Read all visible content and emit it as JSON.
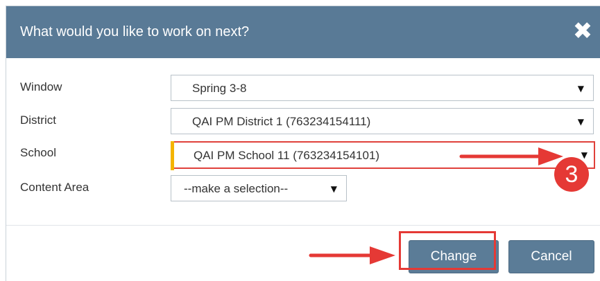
{
  "dialog": {
    "title": "What would you like to work on next?",
    "close_icon": "close-icon",
    "header_color": "#597a96"
  },
  "form": {
    "window": {
      "label": "Window",
      "value": "Spring 3-8"
    },
    "district": {
      "label": "District",
      "value": "QAI PM District 1 (763234154111)"
    },
    "school": {
      "label": "School",
      "value": "QAI PM School 11 (763234154101)"
    },
    "content_area": {
      "label": "Content Area",
      "value": "--make a selection--"
    }
  },
  "buttons": {
    "change": "Change",
    "cancel": "Cancel"
  },
  "annotations": {
    "step_number": "3",
    "accent_color": "#e53935",
    "arrow_icon": "right-arrow-icon"
  }
}
